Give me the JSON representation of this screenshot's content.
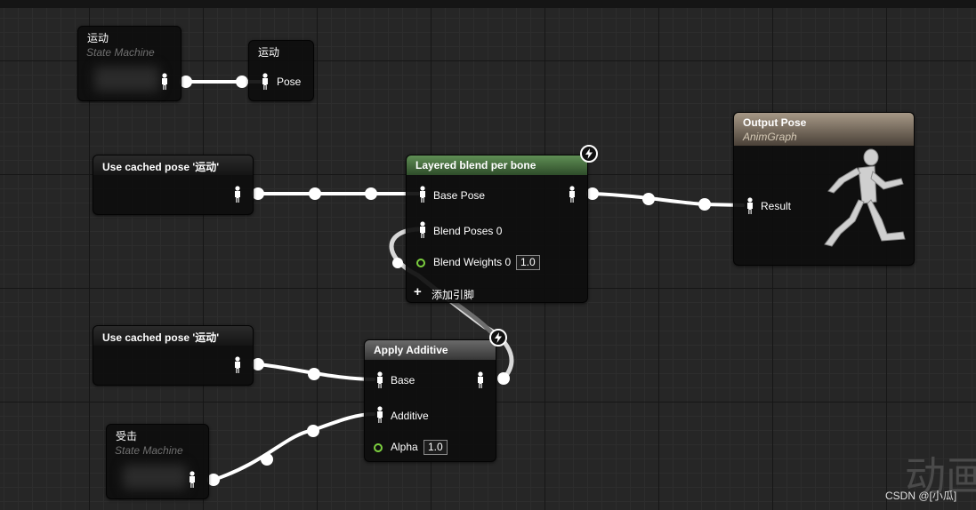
{
  "nodes": {
    "sm_motion": {
      "title": "运动",
      "subtitle": "State Machine"
    },
    "motion_ref": {
      "title": "运动",
      "pin": "Pose"
    },
    "cached1": {
      "title": "Use cached pose '运动'"
    },
    "layered": {
      "title": "Layered blend per bone",
      "base_pose": "Base Pose",
      "blend_poses": "Blend Poses 0",
      "blend_weights": "Blend Weights 0",
      "blend_weights_value": "1.0",
      "add_pin": "添加引脚"
    },
    "output": {
      "title": "Output Pose",
      "subtitle": "AnimGraph",
      "result": "Result"
    },
    "cached2": {
      "title": "Use cached pose '运动'"
    },
    "additive": {
      "title": "Apply Additive",
      "base": "Base",
      "additive": "Additive",
      "alpha": "Alpha",
      "alpha_value": "1.0"
    },
    "sm_hit": {
      "title": "受击",
      "subtitle": "State Machine"
    }
  },
  "watermark": "动画",
  "credit": "CSDN @[小瓜]",
  "colors": {
    "header_green": "#5f8e55",
    "header_grey": "#6a6a6a",
    "header_output": "#a69886",
    "float_pin": "#7ccf3f",
    "wire": "#ffffff"
  }
}
